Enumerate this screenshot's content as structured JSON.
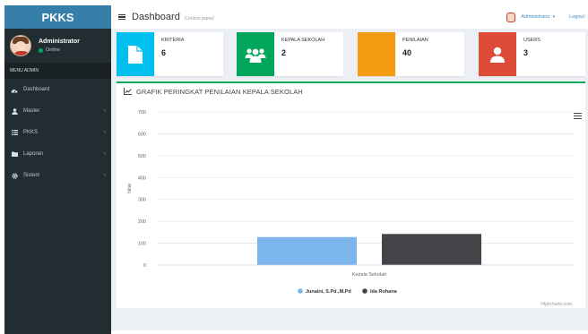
{
  "sidebar": {
    "brand": "PKKS",
    "user_name": "Administrator",
    "user_status": "Online",
    "menu_header": "MENU ADMIN",
    "items": [
      {
        "label": "Dashboard",
        "icon": "dashboard-icon"
      },
      {
        "label": "Master",
        "icon": "user-icon"
      },
      {
        "label": "PKKS",
        "icon": "list-icon"
      },
      {
        "label": "Laporan",
        "icon": "folder-icon"
      },
      {
        "label": "Sistem",
        "icon": "gear-icon"
      }
    ]
  },
  "header": {
    "title": "Dashboard",
    "subtitle": "Control panel",
    "admin_label": "Administrator",
    "logout_label": "Logout"
  },
  "info_boxes": [
    {
      "label": "KRITERIA",
      "value": "6",
      "color": "#00c0ef",
      "icon": "file-icon"
    },
    {
      "label": "KEPALA SEKOLAH",
      "value": "2",
      "color": "#00a65a",
      "icon": "users-icon"
    },
    {
      "label": "PENILAIAN",
      "value": "40",
      "color": "#f39c12",
      "icon": "chart-blank-icon"
    },
    {
      "label": "USERS",
      "value": "3",
      "color": "#dd4b39",
      "icon": "user-icon"
    }
  ],
  "chart_box": {
    "title": "GRAFIK PERINGKAT PENILAIAN KEPALA SEKOLAH",
    "credit": "Highcharts.com"
  },
  "chart_data": {
    "type": "bar",
    "categories": [
      "Kepala Sekolah"
    ],
    "series": [
      {
        "name": "Junaini, S.Pd.,M.Pd",
        "values": [
          128
        ],
        "color": "#7cb5ec"
      },
      {
        "name": "Ida Rohana",
        "values": [
          142
        ],
        "color": "#434348"
      }
    ],
    "xlabel": "Kepala Sekolah",
    "ylabel": "Nilai",
    "ylim": [
      0,
      700
    ],
    "yticks": [
      "0",
      "100",
      "200",
      "300",
      "400",
      "500",
      "600",
      "700"
    ],
    "grid": true,
    "legend_position": "bottom"
  }
}
